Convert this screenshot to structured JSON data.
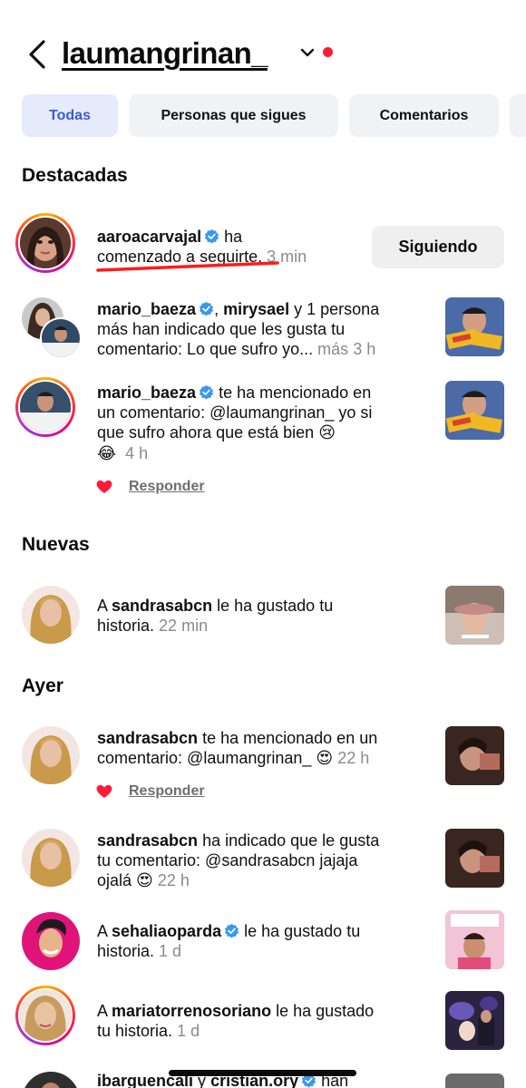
{
  "header": {
    "back_icon": "chevron-left-icon",
    "username": "laumangrinan_",
    "dropdown_icon": "chevron-down-icon",
    "dot_color": "#ff1a33"
  },
  "tabs": [
    {
      "label": "Todas",
      "active": true
    },
    {
      "label": "Personas que sigues",
      "active": false
    },
    {
      "label": "Comentarios",
      "active": false
    }
  ],
  "sections": {
    "featured": "Destacadas",
    "new": "Nuevas",
    "yesterday": "Ayer"
  },
  "featured": {
    "follow": {
      "user": "aaroacarvajal",
      "text_1": "ha",
      "text_2": "comenzado a seguirte.",
      "time": "3 min",
      "button": "Siguiendo"
    },
    "likes": {
      "user1": "mario_baeza",
      "user2": "mirysael",
      "text_1": ", ",
      "text_2": " y 1 persona",
      "line2": "más han indicado que les gusta tu",
      "line3": "comentario: Lo que sufro yo...",
      "more": "más",
      "time": "3 h"
    },
    "mention": {
      "user": "mario_baeza",
      "text_1": "te ha mencionado en",
      "line2": "un comentario: @laumangrinan_ yo si",
      "line3": "que sufro ahora que está bien",
      "emoji_cry": "😢",
      "emoji_laugh": "😂",
      "time": "4 h",
      "reply": "Responder"
    }
  },
  "new": {
    "story_like": {
      "prefix": "A",
      "user": "sandrasabcn",
      "text_1": "le ha gustado tu",
      "line2": "historia.",
      "time": "22 min"
    }
  },
  "yesterday": {
    "mention": {
      "user": "sandrasabcn",
      "text_1": "te ha mencionado en un",
      "line2": "comentario: @laumangrinan_",
      "emoji": "😍",
      "time": "22 h",
      "reply": "Responder"
    },
    "comment_like": {
      "user": "sandrasabcn",
      "text_1": "ha indicado que le gusta",
      "line2": "tu comentario: @sandrasabcn jajaja",
      "line3": "ojalá",
      "emoji": "😍",
      "time": "22 h"
    },
    "story_like_1": {
      "prefix": "A",
      "user": "sehaliaoparda",
      "text_1": "le ha gustado tu",
      "line2": "historia.",
      "time": "1 d"
    },
    "story_like_2": {
      "prefix": "A",
      "user": "mariatorrenosoriano",
      "text_1": "le ha gustado",
      "line2": "tu historia.",
      "time": "1 d"
    },
    "partial": {
      "user1": "ibarguencali",
      "conj": "y",
      "user2": "cristian.ory",
      "text_1": "han"
    }
  },
  "colors": {
    "active_tab_bg": "#e5ebfb",
    "active_tab_text": "#3b5bd6",
    "verified": "#3897f0",
    "heart": "#ff1a3a",
    "underline_mark": "#ff1a1a"
  }
}
